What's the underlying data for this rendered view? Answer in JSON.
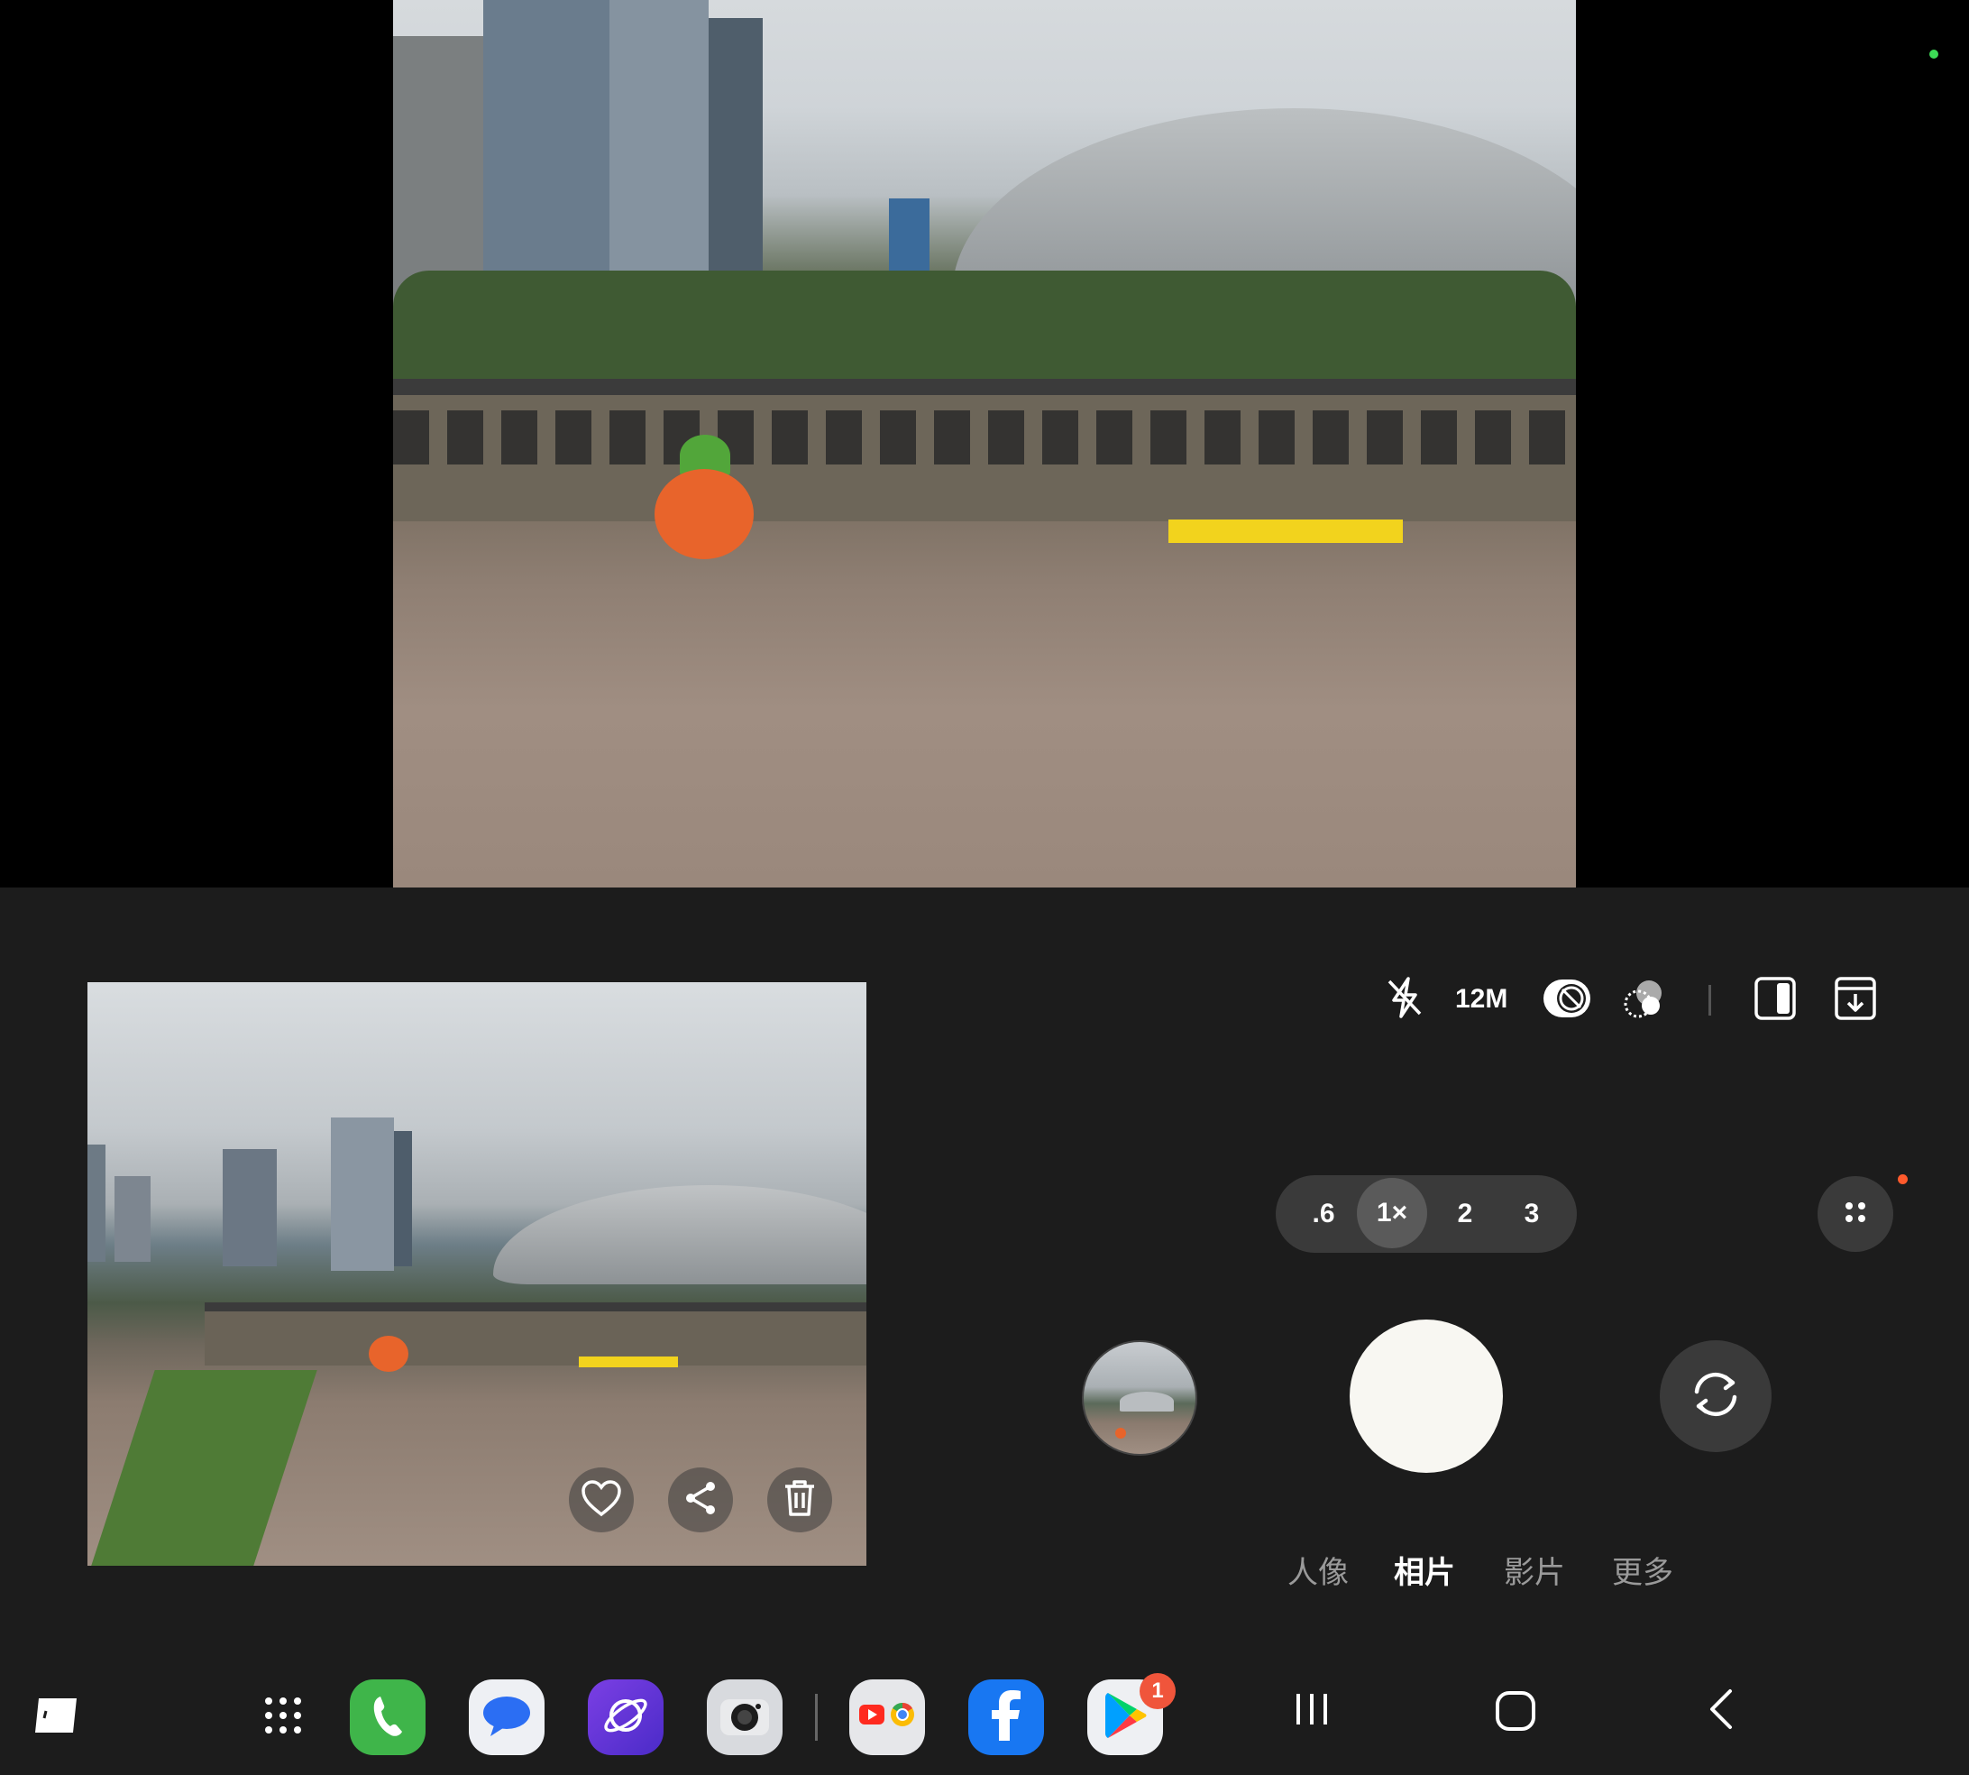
{
  "camera": {
    "resolution": "12M",
    "zoom_options": [
      ".6",
      "1×",
      "2",
      "3"
    ],
    "active_zoom": "1×",
    "modes": [
      "人像",
      "相片",
      "影片",
      "更多"
    ],
    "active_mode": "相片"
  },
  "toolbar_icons": [
    "flash-off-icon",
    "motion-photo-off-icon",
    "filter-icon",
    "aspect-ratio-icon",
    "settings-download-icon"
  ],
  "preview_actions": [
    "heart-icon",
    "share-icon",
    "trash-icon"
  ],
  "dock": {
    "apps": [
      "phone-app",
      "messages-app",
      "internet-app",
      "camera-app",
      "youtube-chrome-folder",
      "facebook-app",
      "play-store-app"
    ],
    "play_store_badge": "1"
  },
  "colors": {
    "background": "#1c1c1c",
    "status_dot": "#3ddc56",
    "notification_dot": "#ff5a2c",
    "badge": "#f0553b"
  }
}
